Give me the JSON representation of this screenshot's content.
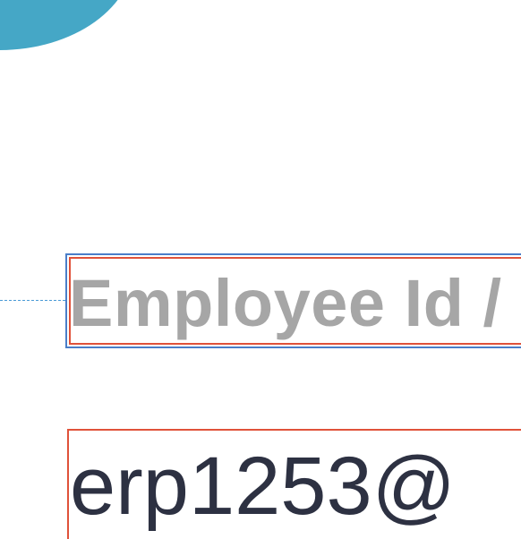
{
  "form": {
    "login_field_label": "Employee Id /",
    "login_field_value": "erp1253@"
  },
  "colors": {
    "accent": "#45a7c6",
    "label_text": "#a6a6a6",
    "value_text": "#2d3142",
    "outline_blue": "#4a7ec9",
    "outline_red": "#e0523a"
  }
}
